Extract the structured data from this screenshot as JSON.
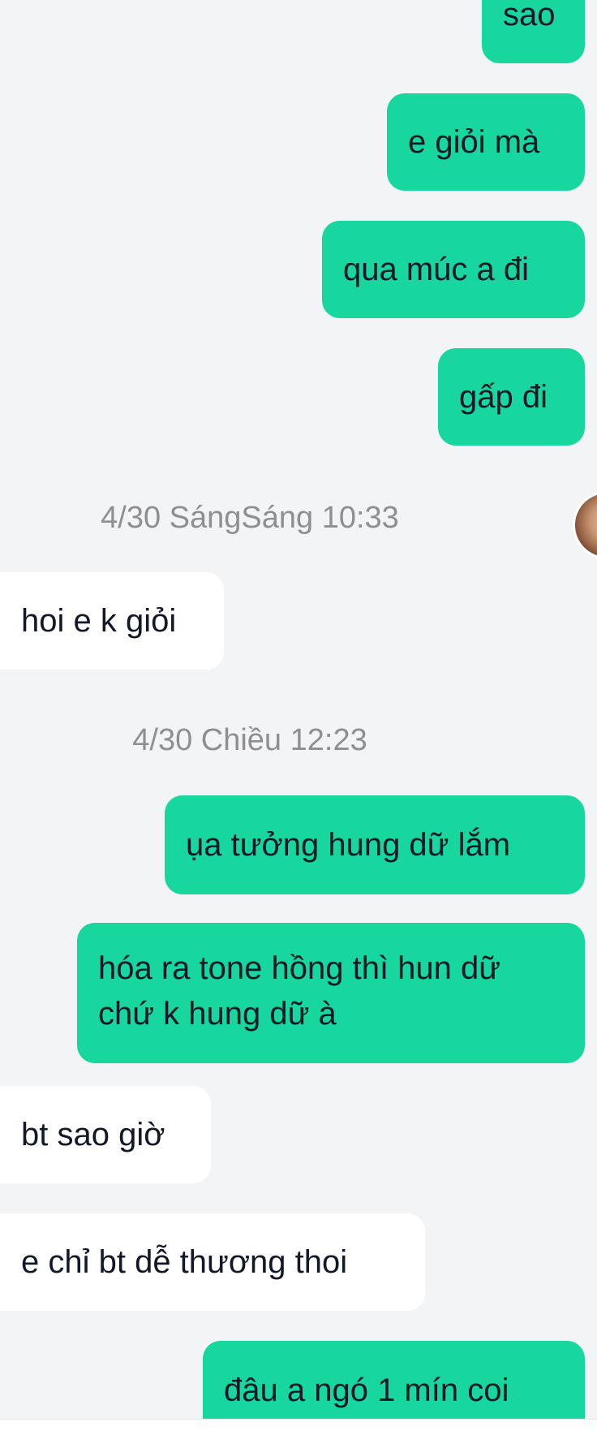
{
  "messages": [
    {
      "id": "m1",
      "side": "out",
      "text": "sao"
    },
    {
      "id": "m2",
      "side": "out",
      "text": "e giỏi mà"
    },
    {
      "id": "m3",
      "side": "out",
      "text": "qua múc a đi"
    },
    {
      "id": "m4",
      "side": "out",
      "text": "gấp đi"
    },
    {
      "id": "t1",
      "type": "timestamp",
      "text": "4/30 SángSáng 10:33"
    },
    {
      "id": "m5",
      "side": "in",
      "text": "hoi e k giỏi"
    },
    {
      "id": "t2",
      "type": "timestamp",
      "text": "4/30 Chiều 12:23"
    },
    {
      "id": "m6",
      "side": "out",
      "text": "ụa tưởng hung dữ lắm"
    },
    {
      "id": "m7",
      "side": "out",
      "text": "hóa ra tone hồng thì hun dữ chứ k hung dữ à"
    },
    {
      "id": "m8",
      "side": "in",
      "text": "bt sao giờ"
    },
    {
      "id": "m9",
      "side": "in",
      "text": "e chỉ bt dễ thương thoi"
    },
    {
      "id": "m10",
      "side": "out",
      "text": "đâu a ngó 1 mín coi"
    }
  ],
  "colors": {
    "outgoing_bubble": "#17d79e",
    "incoming_bubble": "#ffffff",
    "background": "#f3f4f6",
    "timestamp_text": "#8f8f8f"
  },
  "avatar": {
    "icon": "contact-avatar-photo"
  }
}
